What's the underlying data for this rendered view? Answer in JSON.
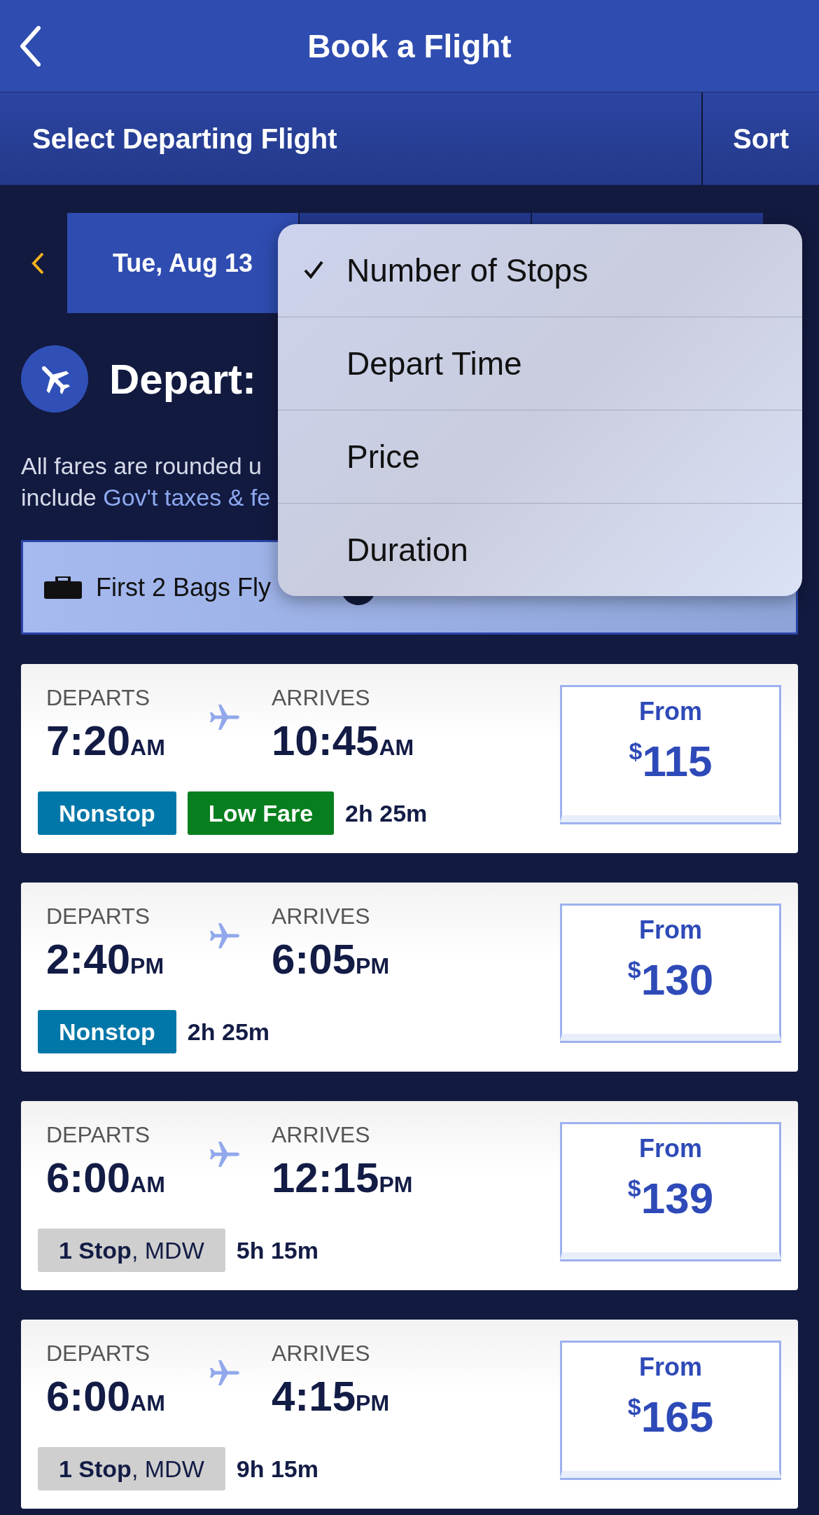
{
  "header": {
    "title": "Book a Flight"
  },
  "subheader": {
    "title": "Select Departing Flight",
    "sort_button": "Sort"
  },
  "date_tabs": [
    {
      "label": "Tue, Aug 13",
      "selected": true
    },
    {
      "selected": false
    },
    {
      "selected": false
    }
  ],
  "depart_heading": "Depart:",
  "note": {
    "line_1": "All fares are rounded u",
    "line_2_prefix": "include ",
    "line_2_link": "Gov't taxes & fe"
  },
  "banner": {
    "bags": "First 2 Bags Fly"
  },
  "sort_menu": [
    {
      "label": "Number of Stops",
      "selected": true
    },
    {
      "label": "Depart Time",
      "selected": false
    },
    {
      "label": "Price",
      "selected": false
    },
    {
      "label": "Duration",
      "selected": false
    }
  ],
  "flights": [
    {
      "departs_label": "DEPARTS",
      "depart_time": "7:20",
      "depart_ampm": "AM",
      "arrives_label": "ARRIVES",
      "arrive_time": "10:45",
      "arrive_ampm": "AM",
      "badges": [
        {
          "kind": "nonstop",
          "text": "Nonstop"
        },
        {
          "kind": "lowfare",
          "text": "Low Fare"
        }
      ],
      "duration": "2h 25m",
      "from_label": "From",
      "currency": "$",
      "price": "115"
    },
    {
      "departs_label": "DEPARTS",
      "depart_time": "2:40",
      "depart_ampm": "PM",
      "arrives_label": "ARRIVES",
      "arrive_time": "6:05",
      "arrive_ampm": "PM",
      "badges": [
        {
          "kind": "nonstop",
          "text": "Nonstop"
        }
      ],
      "duration": "2h 25m",
      "from_label": "From",
      "currency": "$",
      "price": "130"
    },
    {
      "departs_label": "DEPARTS",
      "depart_time": "6:00",
      "depart_ampm": "AM",
      "arrives_label": "ARRIVES",
      "arrive_time": "12:15",
      "arrive_ampm": "PM",
      "badges": [
        {
          "kind": "stop",
          "text": "**1 Stop**, MDW"
        }
      ],
      "duration": "5h 15m",
      "from_label": "From",
      "currency": "$",
      "price": "139"
    },
    {
      "departs_label": "DEPARTS",
      "depart_time": "6:00",
      "depart_ampm": "AM",
      "arrives_label": "ARRIVES",
      "arrive_time": "4:15",
      "arrive_ampm": "PM",
      "badges": [
        {
          "kind": "stop",
          "text": "**1 Stop**, MDW"
        }
      ],
      "duration": "9h 15m",
      "from_label": "From",
      "currency": "$",
      "price": "165"
    }
  ]
}
